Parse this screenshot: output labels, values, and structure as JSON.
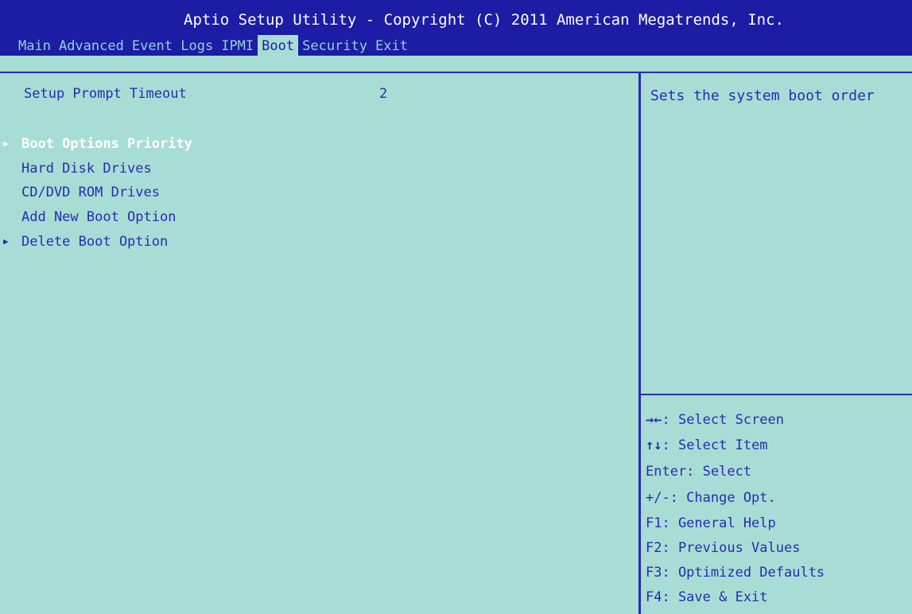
{
  "header": {
    "title": "Aptio Setup Utility - Copyright (C) 2011 American Megatrends, Inc."
  },
  "tabs": [
    {
      "label": "Main"
    },
    {
      "label": "Advanced"
    },
    {
      "label": "Event Logs"
    },
    {
      "label": "IPMI"
    },
    {
      "label": "Boot",
      "active": true
    },
    {
      "label": "Security"
    },
    {
      "label": "Exit"
    }
  ],
  "settings": {
    "setup_prompt_timeout": {
      "label": "Setup Prompt Timeout",
      "value": "2"
    }
  },
  "menu": [
    {
      "label": "Boot Options Priority",
      "selected": true,
      "submenu": true
    },
    {
      "label": "Hard Disk Drives"
    },
    {
      "label": "CD/DVD ROM Drives"
    },
    {
      "label": "Add New Boot Option"
    },
    {
      "label": "Delete Boot Option",
      "submenu": true
    }
  ],
  "help_text": "Sets the system boot order",
  "keys": [
    {
      "sym": "→←",
      "text": ": Select Screen"
    },
    {
      "sym": "↑↓",
      "text": ": Select Item"
    },
    {
      "sym": "",
      "text": "Enter: Select"
    },
    {
      "sym": "",
      "text": "+/-: Change Opt."
    },
    {
      "sym": "",
      "text": "F1: General Help"
    },
    {
      "sym": "",
      "text": "F2: Previous Values"
    },
    {
      "sym": "",
      "text": "F3: Optimized Defaults"
    },
    {
      "sym": "",
      "text": "F4: Save & Exit"
    }
  ],
  "colors": {
    "background": "#a8ddd6",
    "header": "#1c1ca4",
    "text": "#2b2bb0",
    "selected_text": "#ffffff"
  }
}
